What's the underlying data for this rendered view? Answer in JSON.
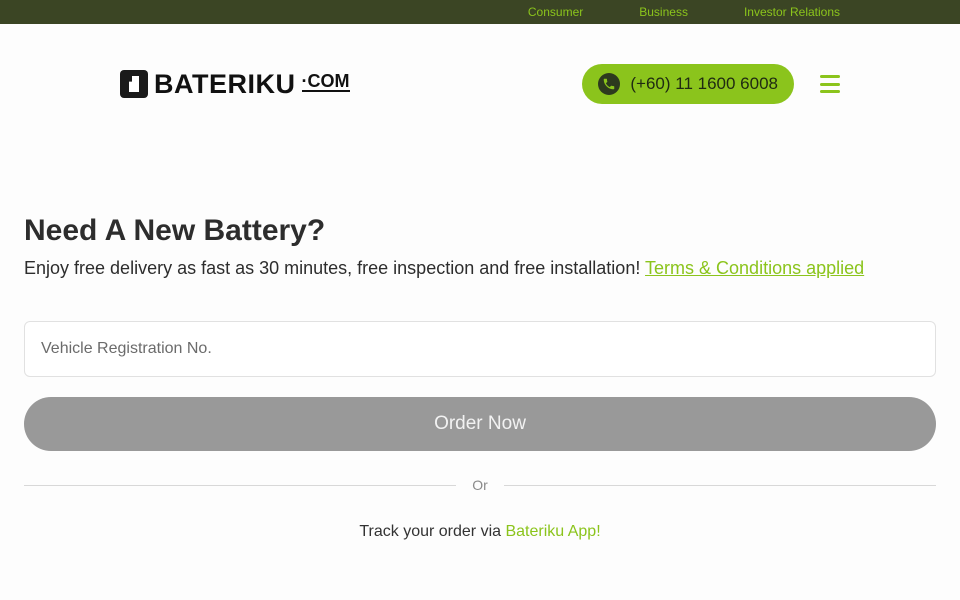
{
  "topbar": {
    "links": [
      "Consumer",
      "Business",
      "Investor Relations"
    ]
  },
  "brand": {
    "name": "BATERIKU",
    "suffix": "·COM",
    "accent": "#8bc41c",
    "dark_bar": "#3b4524"
  },
  "header": {
    "phone": "(+60) 11 1600 6008",
    "phone_icon": "whatsapp-icon",
    "menu_icon": "hamburger-menu-icon"
  },
  "main": {
    "title": "Need A New Battery?",
    "subtitle": "Enjoy free delivery as fast as 30 minutes, free inspection and free installation!",
    "terms_link": "Terms & Conditions applied",
    "input_placeholder": "Vehicle Registration No.",
    "order_button": "Order Now",
    "divider_text": "Or",
    "track_text": "Track your order via",
    "track_link": "Bateriku App!"
  }
}
